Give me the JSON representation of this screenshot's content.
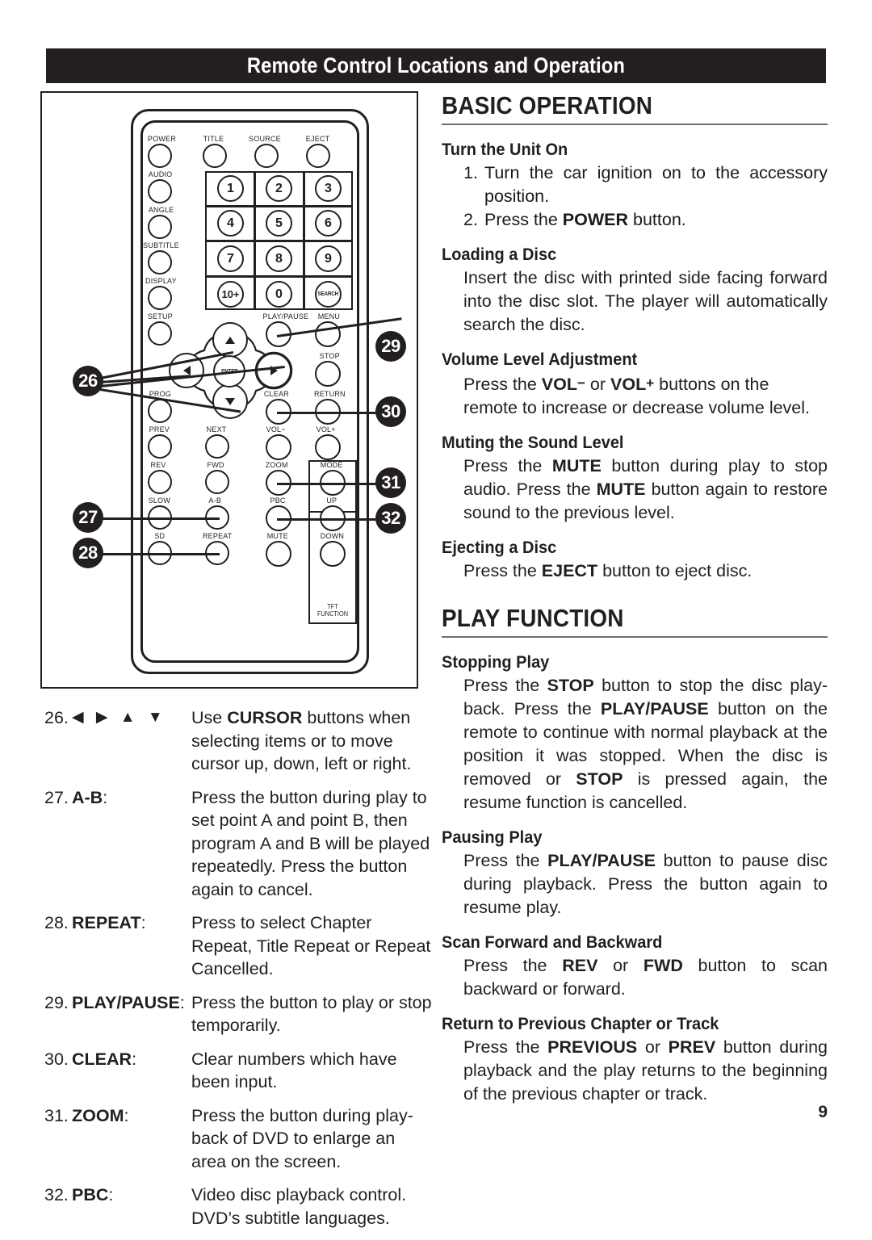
{
  "header": {
    "title": "Remote Control Locations and Operation"
  },
  "remote": {
    "buttons": [
      {
        "label": "POWER",
        "glyph": ""
      },
      {
        "label": "TITLE",
        "glyph": ""
      },
      {
        "label": "SOURCE",
        "glyph": ""
      },
      {
        "label": "EJECT",
        "glyph": ""
      },
      {
        "label": "AUDIO",
        "glyph": ""
      },
      {
        "label": "ANGLE",
        "glyph": ""
      },
      {
        "label": "SUBTITLE",
        "glyph": ""
      },
      {
        "label": "DISPLAY",
        "glyph": ""
      },
      {
        "label": "SETUP",
        "glyph": ""
      },
      {
        "label": "PROG",
        "glyph": ""
      },
      {
        "label": "PREV",
        "glyph": ""
      },
      {
        "label": "NEXT",
        "glyph": ""
      },
      {
        "label": "REV",
        "glyph": ""
      },
      {
        "label": "FWD",
        "glyph": ""
      },
      {
        "label": "SLOW",
        "glyph": ""
      },
      {
        "label": "A-B",
        "glyph": ""
      },
      {
        "label": "SD",
        "glyph": ""
      },
      {
        "label": "REPEAT",
        "glyph": ""
      },
      {
        "label": "PLAY/PAUSE",
        "glyph": ""
      },
      {
        "label": "MENU",
        "glyph": ""
      },
      {
        "label": "STOP",
        "glyph": ""
      },
      {
        "label": "CLEAR",
        "glyph": ""
      },
      {
        "label": "RETURN",
        "glyph": ""
      },
      {
        "label": "VOL−",
        "glyph": ""
      },
      {
        "label": "VOL+",
        "glyph": ""
      },
      {
        "label": "ZOOM",
        "glyph": ""
      },
      {
        "label": "PBC",
        "glyph": ""
      },
      {
        "label": "MUTE",
        "glyph": ""
      },
      {
        "label": "MODE",
        "glyph": ""
      },
      {
        "label": "UP",
        "glyph": ""
      },
      {
        "label": "DOWN",
        "glyph": ""
      }
    ],
    "numeric_keys": [
      "1",
      "2",
      "3",
      "4",
      "5",
      "6",
      "7",
      "8",
      "9",
      "10+",
      "0",
      "SEARCH"
    ],
    "enter_label": "ENTER",
    "tft_label_line1": "TFT",
    "tft_label_line2": "FUNCTION",
    "callouts": [
      "26",
      "27",
      "28",
      "29",
      "30",
      "31",
      "32"
    ]
  },
  "legend": [
    {
      "num": "26.",
      "key": "◀ ▶ ▲ ▼",
      "key_is_arrows": true,
      "body_pre": "Use ",
      "body_bold": "CURSOR",
      "body_post": " buttons when selecting items or to move cursor up, down, left or right."
    },
    {
      "num": "27.",
      "key": "A-B",
      "key_is_arrows": false,
      "body_pre": "",
      "body_bold": "",
      "body_post": "Press the button during play to set point A and point B, then program A and B will be played repeatedly. Press the button again to cancel."
    },
    {
      "num": "28.",
      "key": "REPEAT",
      "key_is_arrows": false,
      "body_pre": "",
      "body_bold": "",
      "body_post": "Press to select Chapter Repeat, Title Repeat or Repeat Cancelled."
    },
    {
      "num": "29.",
      "key": "PLAY/PAUSE",
      "key_is_arrows": false,
      "body_pre": "",
      "body_bold": "",
      "body_post": "Press the button to play or stop temporarily."
    },
    {
      "num": "30.",
      "key": "CLEAR",
      "key_is_arrows": false,
      "body_pre": "",
      "body_bold": "",
      "body_post": "Clear numbers which have been input."
    },
    {
      "num": "31.",
      "key": "ZOOM",
      "key_is_arrows": false,
      "body_pre": "",
      "body_bold": "",
      "body_post": "Press the button during play-back of DVD to enlarge an area on the screen."
    },
    {
      "num": "32.",
      "key": "PBC",
      "key_is_arrows": false,
      "body_pre": "",
      "body_bold": "",
      "body_post": "Video disc playback control. DVD’s subtitle languages."
    }
  ],
  "basic_operation": {
    "title": "BASIC OPERATION",
    "turn_on": {
      "heading": "Turn the Unit On",
      "step1_num": "1.",
      "step1_text": "Turn the car ignition on to the accessory position.",
      "step2_num": "2.",
      "step2_pre": "Press the ",
      "step2_bold": "POWER",
      "step2_post": " button."
    },
    "loading": {
      "heading": "Loading a Disc",
      "text": "Insert the disc with printed side facing forward into the disc slot. The player will automatically search the disc."
    },
    "volume": {
      "heading": "Volume Level Adjustment",
      "pre": "Press the ",
      "bold1": "VOL",
      "sup1": "−",
      "mid": " or ",
      "bold2": "VOL",
      "sup2": "+",
      "post": " buttons on the remote to increase or decrease volume level."
    },
    "mute": {
      "heading": "Muting the Sound Level",
      "pre": "Press the ",
      "bold1": "MUTE",
      "mid": " button during play to stop audio. Press the ",
      "bold2": "MUTE",
      "post": " button again to restore sound to the previous level."
    },
    "eject": {
      "heading": "Ejecting a Disc",
      "pre": "Press the ",
      "bold1": "EJECT",
      "post": " button to eject disc."
    }
  },
  "play_function": {
    "title": "PLAY FUNCTION",
    "stopping": {
      "heading": "Stopping Play",
      "pre": "Press the ",
      "bold1": "STOP",
      "mid1": " button to stop the disc play-back. Press the ",
      "bold2": "PLAY/PAUSE",
      "mid2": " button on the remote to continue with normal playback at the position it was stopped. When the disc is removed or ",
      "bold3": "STOP",
      "post": " is pressed again, the resume function is cancelled."
    },
    "pausing": {
      "heading": "Pausing Play",
      "pre": "Press the ",
      "bold1": "PLAY/PAUSE",
      "post": " button to pause disc during playback. Press the button again to resume play."
    },
    "scan": {
      "heading": "Scan Forward and Backward",
      "pre": "Press the ",
      "bold1": "REV",
      "mid": " or ",
      "bold2": "FWD",
      "post": " button to scan backward or forward."
    },
    "previous": {
      "heading": "Return to Previous Chapter or Track",
      "pre": "Press the ",
      "bold1": "PREVIOUS",
      "mid": " or ",
      "bold2": "PREV",
      "post": " button during playback and the play returns to the beginning of the previous chapter or track."
    }
  },
  "page_number": "9"
}
